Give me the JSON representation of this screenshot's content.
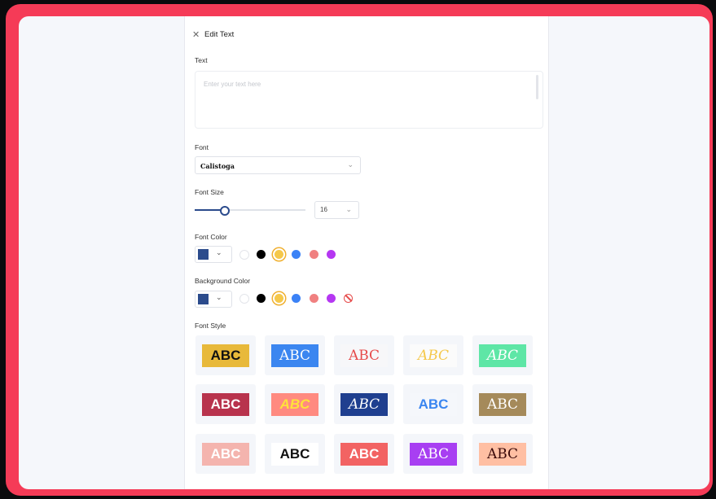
{
  "panel": {
    "title": "Edit Text",
    "text_label": "Text",
    "text_placeholder": "Enter your text here",
    "font_label": "Font",
    "font_value": "Calistoga",
    "font_size_label": "Font Size",
    "font_size_value": "16",
    "font_size_fraction": 0.27,
    "font_color_label": "Font Color",
    "font_color_selected": "#2b4b8c",
    "bg_color_label": "Background Color",
    "bg_color_selected": "#2b4b8c",
    "swatches": [
      "#ffffff",
      "#000000",
      "#f5c84b",
      "#3b82f6",
      "#f08080",
      "#b537f2"
    ],
    "selected_swatch_index": 2,
    "font_style_label": "Font Style",
    "styles": [
      {
        "text": "ABC",
        "bg": "#e8b93a",
        "fg": "#111111",
        "font": "sans"
      },
      {
        "text": "ABC",
        "bg": "#3b86f0",
        "fg": "#ffffff",
        "font": "serif"
      },
      {
        "text": "ABC",
        "bg": "#f7f7f9",
        "fg": "#e64b4b",
        "font": "serif"
      },
      {
        "text": "ABC",
        "bg": "#fbfbfb",
        "fg": "#f5c84b",
        "font": "serif-italic"
      },
      {
        "text": "ABC",
        "bg": "#5ee6a6",
        "fg": "#ffffff",
        "font": "serif-italic"
      },
      {
        "text": "ABC",
        "bg": "#b8334d",
        "fg": "#ffffff",
        "font": "sans"
      },
      {
        "text": "ABC",
        "bg": "#ff8a80",
        "fg": "#ffe23a",
        "font": "sans-italic"
      },
      {
        "text": "ABC",
        "bg": "#1f3f8f",
        "fg": "#ffffff",
        "font": "serif-italic"
      },
      {
        "text": "ABC",
        "bg": "#f5f7fb",
        "fg": "#3b86f0",
        "font": "sans"
      },
      {
        "text": "ABC",
        "bg": "#a58a5a",
        "fg": "#ffffff",
        "font": "serif"
      },
      {
        "text": "ABC",
        "bg": "#f4b4ae",
        "fg": "#ffffff",
        "font": "sans"
      },
      {
        "text": "ABC",
        "bg": "#ffffff",
        "fg": "#111111",
        "font": "sans"
      },
      {
        "text": "ABC",
        "bg": "#f26363",
        "fg": "#ffffff",
        "font": "sans"
      },
      {
        "text": "ABC",
        "bg": "#a83ff2",
        "fg": "#ffffff",
        "font": "serif"
      },
      {
        "text": "ABC",
        "bg": "#ffbfa3",
        "fg": "#3a0a0a",
        "font": "serif"
      }
    ]
  }
}
